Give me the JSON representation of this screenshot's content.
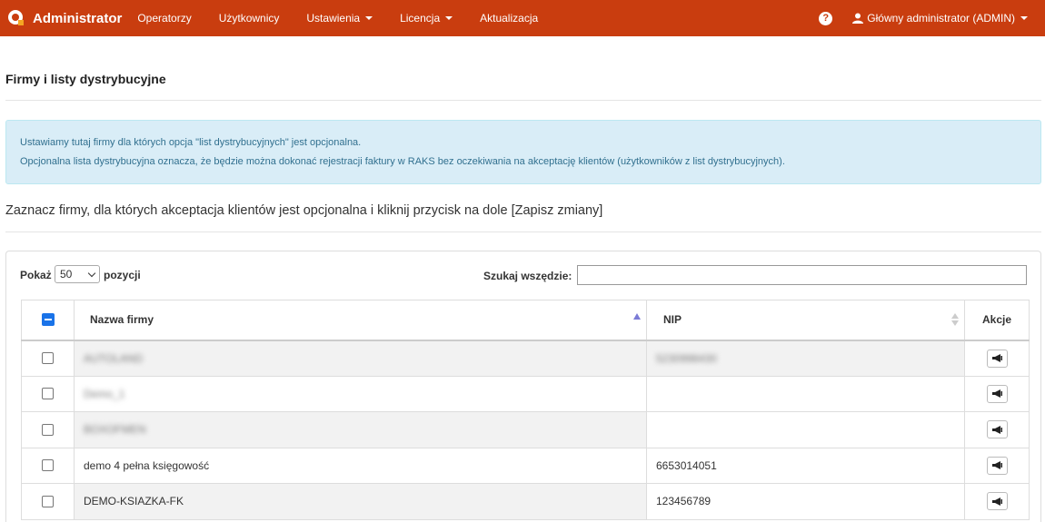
{
  "navbar": {
    "brand": "Administrator",
    "items": [
      {
        "label": "Operatorzy",
        "dropdown": false
      },
      {
        "label": "Użytkownicy",
        "dropdown": false
      },
      {
        "label": "Ustawienia",
        "dropdown": true
      },
      {
        "label": "Licencja",
        "dropdown": true
      },
      {
        "label": "Aktualizacja",
        "dropdown": false
      }
    ],
    "help_glyph": "?",
    "user": "Główny administrator (ADMIN)",
    "color": "#c93d0f"
  },
  "page": {
    "title": "Firmy i listy dystrybucyjne",
    "info_line1": "Ustawiamy tutaj firmy dla których opcja \"list dystrybucyjnych\" jest opcjonalna.",
    "info_line2": "Opcjonalna lista dystrybucyjna oznacza, że będzie można dokonać rejestracji faktury w RAKS bez oczekiwania na akceptację klientów (użytkowników z list dystrybucyjnych).",
    "instruction": "Zaznacz firmy, dla których akceptacja klientów jest opcjonalna i kliknij przycisk na dole [Zapisz zmiany]"
  },
  "table_controls": {
    "show_label": "Pokaż",
    "page_size": "50",
    "positions_label": "pozycji",
    "search_label": "Szukaj wszędzie:",
    "search_value": ""
  },
  "table": {
    "columns": [
      "Nazwa firmy",
      "NIP",
      "Akcje"
    ],
    "rows": [
      {
        "name": "AUTOLAND",
        "nip": "5230998430",
        "redacted": true,
        "checked": false
      },
      {
        "name": "Demo_1",
        "nip": "",
        "redacted": true,
        "checked": false
      },
      {
        "name": "BOXOFMEN",
        "nip": "",
        "redacted": true,
        "checked": false
      },
      {
        "name": "demo 4 pełna księgowość",
        "nip": "6653014051",
        "redacted": false,
        "checked": false
      },
      {
        "name": "DEMO-KSIAZKA-FK",
        "nip": "123456789",
        "redacted": false,
        "checked": false
      }
    ]
  }
}
